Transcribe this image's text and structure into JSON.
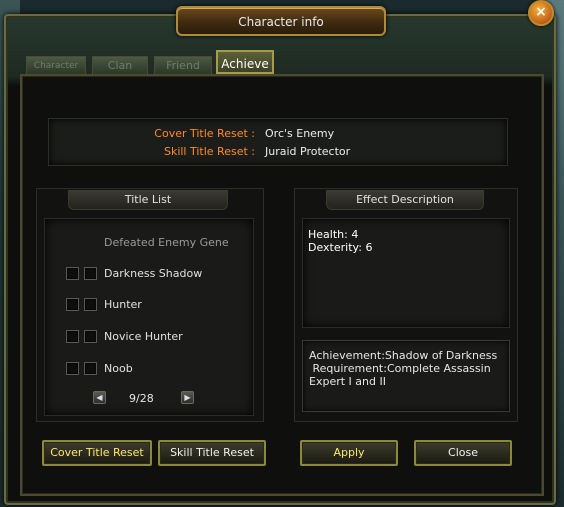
{
  "window": {
    "title": "Character info",
    "close_glyph": "×"
  },
  "tabs": [
    {
      "label": "Character",
      "active": false
    },
    {
      "label": "Clan",
      "active": false
    },
    {
      "label": "Friend",
      "active": false
    },
    {
      "label": "Achieve",
      "active": true
    }
  ],
  "reset_info": {
    "cover_label": "Cover Title Reset :",
    "cover_value": "Orc's Enemy",
    "skill_label": "Skill Title Reset :",
    "skill_value": "Juraid Protector"
  },
  "title_list": {
    "header": "Title List",
    "group_header": "Defeated Enemy Gene",
    "items": [
      "Darkness Shadow",
      "Hunter",
      "Novice Hunter",
      "Noob"
    ],
    "page": "9/28"
  },
  "effect": {
    "header": "Effect Description",
    "lines": [
      "Health: 4",
      "Dexterity: 6"
    ],
    "achievement_text": "Achievement:Shadow of Darkness\n Requirement:Complete Assassin Expert I and II"
  },
  "buttons": {
    "cover_reset": "Cover Title Reset",
    "skill_reset": "Skill Title Reset",
    "apply": "Apply",
    "close": "Close"
  },
  "colors": {
    "label_orange": "#ff8a2a",
    "button_text_yellow": "#ffe86a",
    "frame_gold": "#a89a48"
  }
}
